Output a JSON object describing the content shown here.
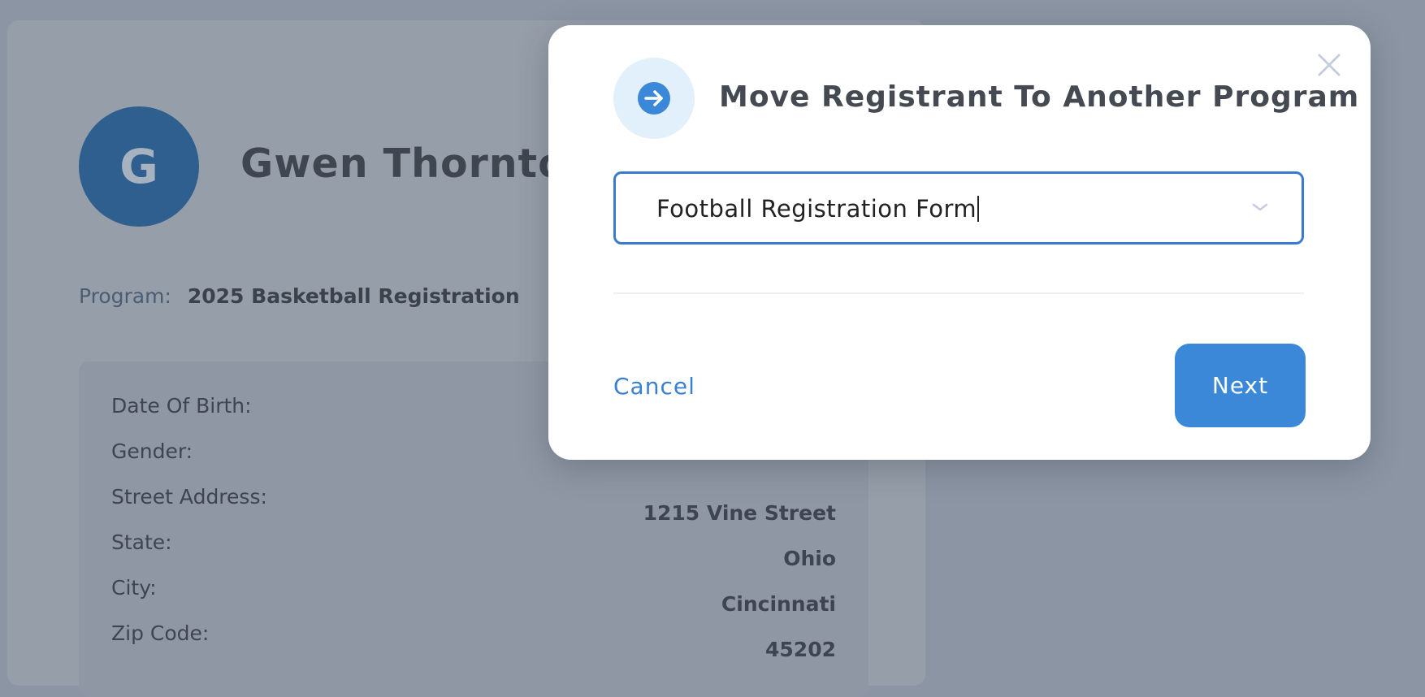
{
  "profile": {
    "avatar_initial": "G",
    "name": "Gwen Thornton",
    "program_label": "Program:",
    "program_value": "2025 Basketball Registration"
  },
  "details": {
    "date_of_birth_label": "Date Of Birth:",
    "gender_label": "Gender:",
    "street_label": "Street Address:",
    "street_value": "1215 Vine Street",
    "state_label": "State:",
    "state_value": "Ohio",
    "city_label": "City:",
    "city_value": "Cincinnati",
    "zip_label": "Zip Code:",
    "zip_value": "45202"
  },
  "modal": {
    "title": "Move Registrant To Another Program",
    "title_icon": "arrow-right-circle-icon",
    "select_value": "Football Registration Form",
    "cancel_label": "Cancel",
    "next_label": "Next",
    "colors": {
      "accent": "#3b87d8",
      "icon_bg": "#e1f0fb"
    }
  }
}
